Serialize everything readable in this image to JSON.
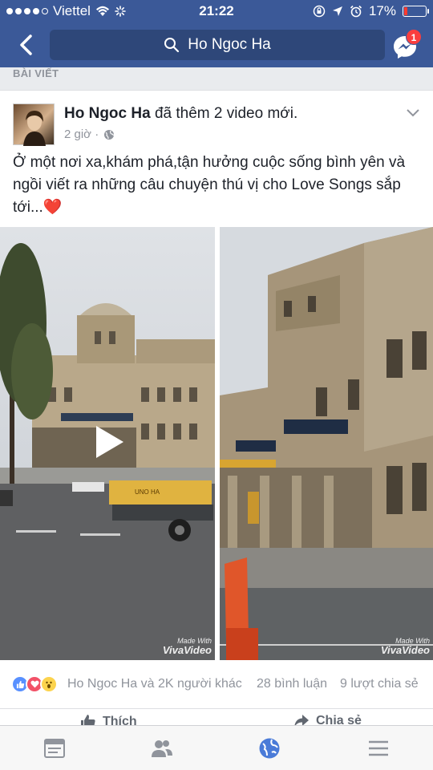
{
  "status_bar": {
    "carrier": "Viettel",
    "time": "21:22",
    "battery_percent": "17%",
    "battery_level": 0.17
  },
  "nav": {
    "search_value": "Ho Ngoc Ha",
    "messenger_badge": "1"
  },
  "section_label": "BÀI VIẾT",
  "post": {
    "author": "Ho Ngoc Ha",
    "action_text": " đã thêm 2 video mới.",
    "time": "2 giờ ·",
    "text": "Ở một nơi xa,khám phá,tận hưởng cuộc sống bình yên và ngồi viết ra những câu chuyện thú vị cho Love Songs sắp tới...",
    "heart": "❤️",
    "watermark_top": "Made With",
    "watermark_brand": "VivaVideo",
    "truck_label": "UNO HA",
    "reactions_names": "Ho Ngoc Ha và 2K người khác",
    "comments": "28 bình luận",
    "shares": "9 lượt chia sẻ",
    "like_label": "Thích",
    "share_label": "Chia sẻ"
  },
  "colors": {
    "brand": "#3b5998",
    "badge": "#fa3e3e"
  },
  "icons": [
    "back-arrow-icon",
    "search-icon",
    "messenger-icon",
    "globe-icon",
    "chevron-down-icon",
    "play-icon",
    "like-reaction-icon",
    "love-reaction-icon",
    "wow-reaction-icon",
    "thumbs-up-icon",
    "share-arrow-icon",
    "news-feed-icon",
    "friends-icon",
    "notifications-globe-icon",
    "menu-icon"
  ]
}
